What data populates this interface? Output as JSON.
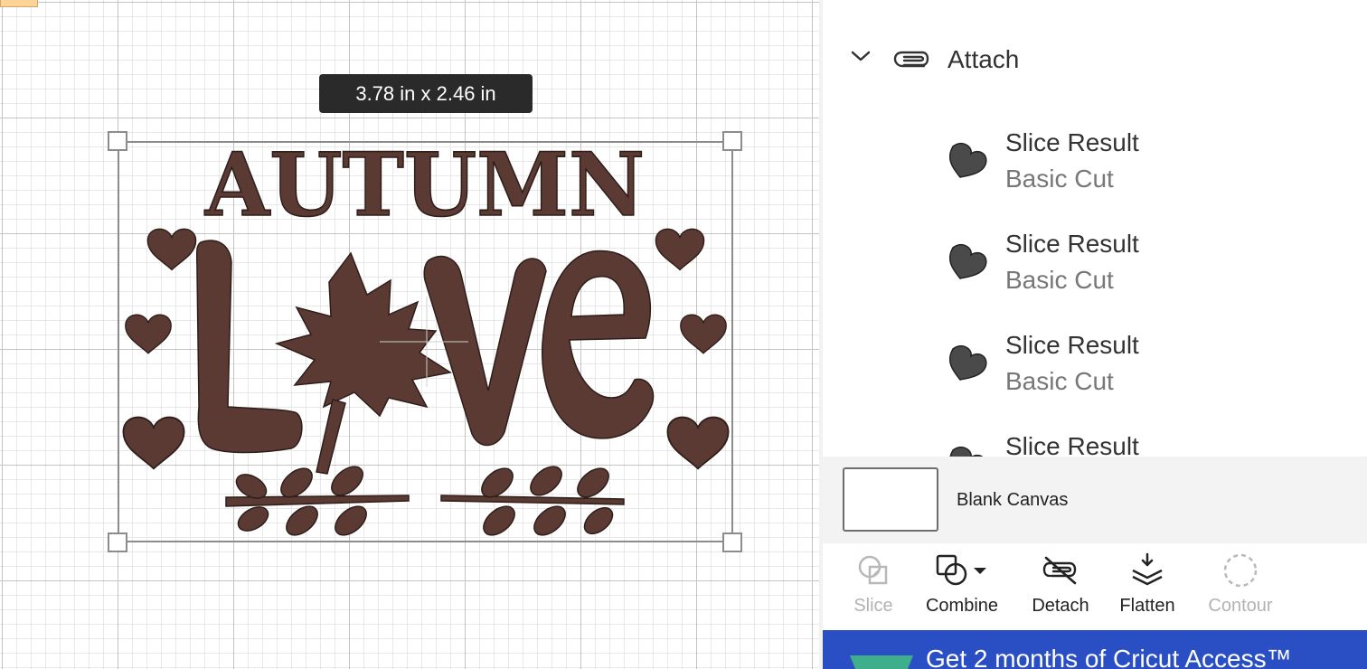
{
  "canvas": {
    "size_readout": "3.78  in x 2.46  in",
    "design_text_top": "AUTUMN",
    "design_text_main_start": "L",
    "design_text_main_end": "ve",
    "design_color": "#5a3a32"
  },
  "layers": {
    "group_label": "Attach",
    "items": [
      {
        "name": "Slice Result",
        "type": "Basic Cut"
      },
      {
        "name": "Slice Result",
        "type": "Basic Cut"
      },
      {
        "name": "Slice Result",
        "type": "Basic Cut"
      },
      {
        "name": "Slice Result",
        "type": ""
      }
    ],
    "blank_canvas_label": "Blank Canvas"
  },
  "toolbar": {
    "slice": "Slice",
    "combine": "Combine",
    "detach": "Detach",
    "flatten": "Flatten",
    "contour": "Contour"
  },
  "promo": {
    "text": "Get 2 months of Cricut Access™",
    "color": "#2a4fc4"
  }
}
